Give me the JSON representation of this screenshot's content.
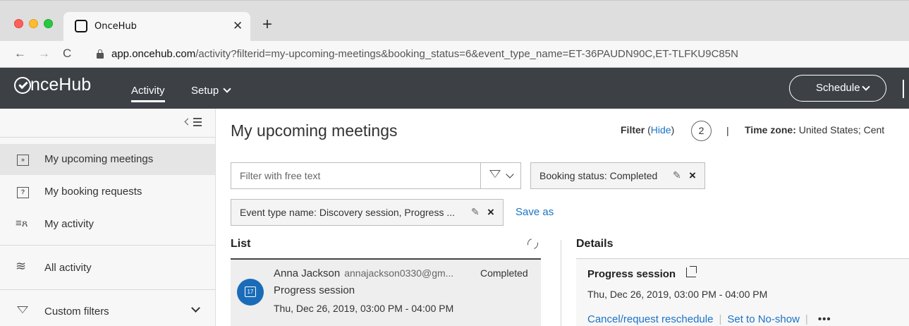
{
  "browser": {
    "tab_title": "OnceHub",
    "url_host": "app.oncehub.com",
    "url_path": "/activity?filterid=my-upcoming-meetings&booking_status=6&event_type_name=ET-36PAUDN90C,ET-TLFKU9C85N"
  },
  "header": {
    "logo_text": "OnceHub",
    "nav_activity": "Activity",
    "nav_setup": "Setup",
    "schedule_label": "Schedule"
  },
  "sidebar": {
    "items": [
      {
        "label": "My upcoming meetings",
        "icon": "upcoming-icon"
      },
      {
        "label": "My booking requests",
        "icon": "booking-request-icon"
      },
      {
        "label": "My activity",
        "icon": "my-activity-icon"
      },
      {
        "label": "All activity",
        "icon": "all-activity-icon"
      },
      {
        "label": "Custom filters",
        "icon": "funnel-icon"
      }
    ]
  },
  "main": {
    "title": "My upcoming meetings",
    "filter_label": "Filter",
    "filter_hide": "Hide",
    "filter_count": "2",
    "timezone_label": "Time zone:",
    "timezone_value": "United States; Cent",
    "search_placeholder": "Filter with free text",
    "chips": [
      {
        "text": "Booking status: Completed"
      },
      {
        "text": "Event type name: Discovery session, Progress ..."
      }
    ],
    "save_as": "Save as"
  },
  "list": {
    "title": "List",
    "rows": [
      {
        "name": "Anna Jackson",
        "email": "annajackson0330@gm...",
        "status": "Completed",
        "type": "Progress session",
        "time": "Thu, Dec 26, 2019, 03:00 PM - 04:00 PM",
        "calendar_day": "17"
      }
    ]
  },
  "details": {
    "title": "Details",
    "type": "Progress session",
    "time": "Thu, Dec 26, 2019, 03:00 PM - 04:00 PM",
    "action_cancel": "Cancel/request reschedule",
    "action_noshow": "Set to No-show",
    "action_more": "•••"
  }
}
